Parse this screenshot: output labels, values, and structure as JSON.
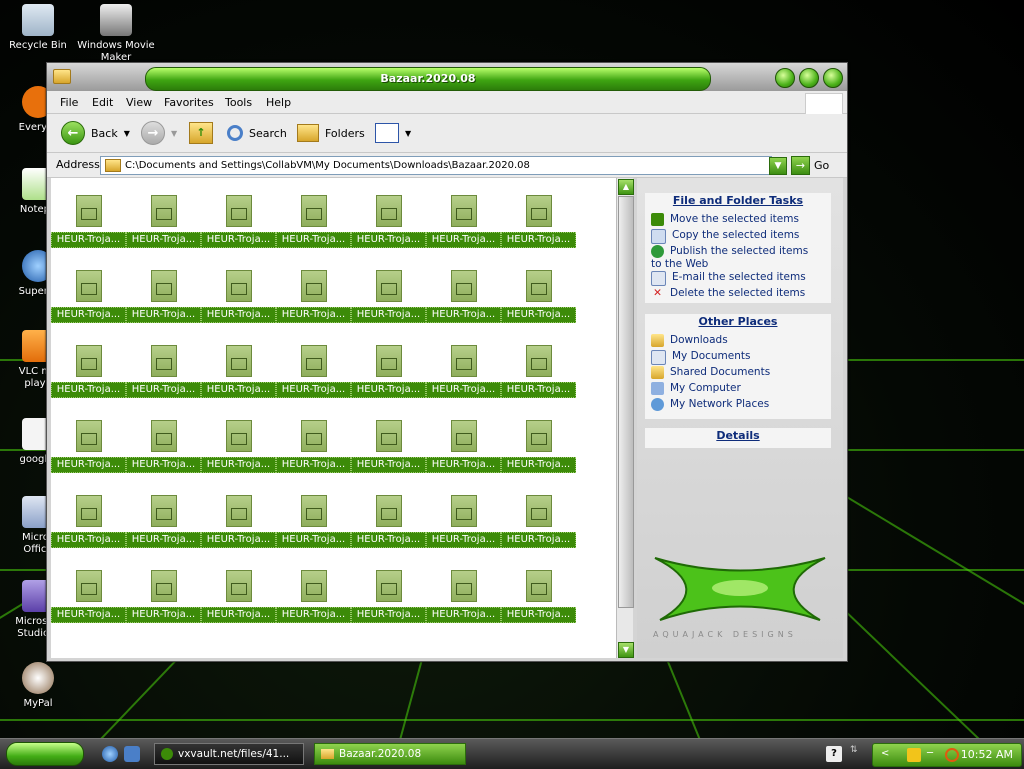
{
  "desktop": {
    "icons": [
      {
        "label": "Recycle Bin"
      },
      {
        "label": "Windows Movie Maker"
      },
      {
        "label": "Everyth"
      },
      {
        "label": "Notepa"
      },
      {
        "label": "Superm"
      },
      {
        "label": "VLC me playe"
      },
      {
        "label": "google."
      },
      {
        "label": "Micros Office"
      },
      {
        "label": "Microsoft Studio 2"
      },
      {
        "label": "MyPal"
      }
    ]
  },
  "window": {
    "title": "Bazaar.2020.08",
    "menu": [
      "File",
      "Edit",
      "View",
      "Favorites",
      "Tools",
      "Help"
    ],
    "toolbar": {
      "back": "Back",
      "search": "Search",
      "folders": "Folders"
    },
    "address": {
      "label": "Address",
      "value": "C:\\Documents and Settings\\CollabVM\\My Documents\\Downloads\\Bazaar.2020.08",
      "go": "Go"
    },
    "files": {
      "item_label": "HEUR-Troja...",
      "columns": 7,
      "rows": 7
    },
    "taskpane": {
      "file_tasks": {
        "title": "File and Folder Tasks",
        "items": [
          "Move the selected items",
          "Copy the selected items",
          "Publish the selected items to the Web",
          "E-mail the selected items",
          "Delete the selected items"
        ]
      },
      "other_places": {
        "title": "Other Places",
        "items": [
          "Downloads",
          "My Documents",
          "Shared Documents",
          "My Computer",
          "My Network Places"
        ]
      },
      "details": {
        "title": "Details"
      },
      "logo_caption": "AQUAJACK DESIGNS"
    }
  },
  "taskbar": {
    "tasks": [
      {
        "label": "vxvault.net/files/41..."
      },
      {
        "label": "Bazaar.2020.08"
      }
    ],
    "clock": "10:52 AM"
  },
  "colors": {
    "accent": "#3c8b08",
    "link": "#0e2c7a"
  }
}
